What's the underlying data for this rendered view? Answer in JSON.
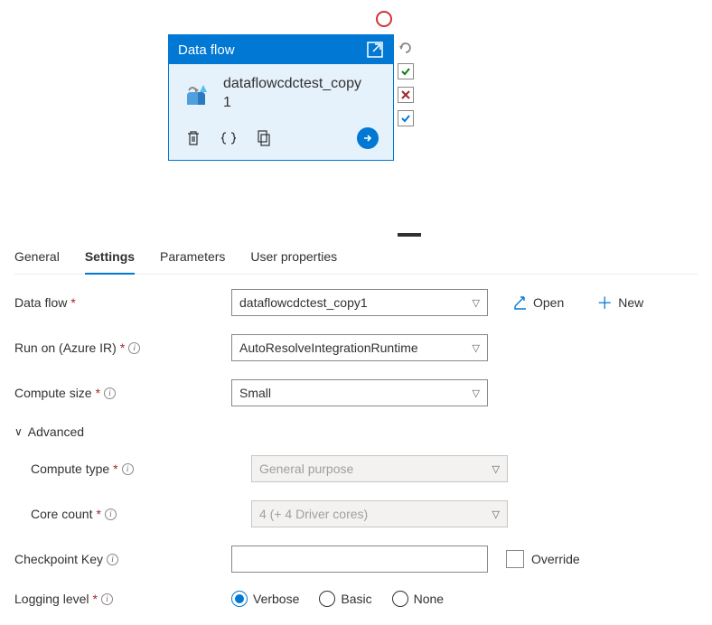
{
  "card": {
    "header": "Data flow",
    "title": "dataflowcdctest_copy1"
  },
  "tabs": {
    "general": "General",
    "settings": "Settings",
    "parameters": "Parameters",
    "user_properties": "User properties"
  },
  "form": {
    "data_flow": {
      "label": "Data flow",
      "value": "dataflowcdctest_copy1"
    },
    "open": "Open",
    "new": "New",
    "run_on": {
      "label": "Run on (Azure IR)",
      "value": "AutoResolveIntegrationRuntime"
    },
    "compute_size": {
      "label": "Compute size",
      "value": "Small"
    },
    "advanced": "Advanced",
    "compute_type": {
      "label": "Compute type",
      "value": "General purpose"
    },
    "core_count": {
      "label": "Core count",
      "value": "4 (+ 4 Driver cores)"
    },
    "checkpoint": {
      "label": "Checkpoint Key",
      "override": "Override"
    },
    "logging": {
      "label": "Logging level",
      "verbose": "Verbose",
      "basic": "Basic",
      "none": "None"
    }
  }
}
